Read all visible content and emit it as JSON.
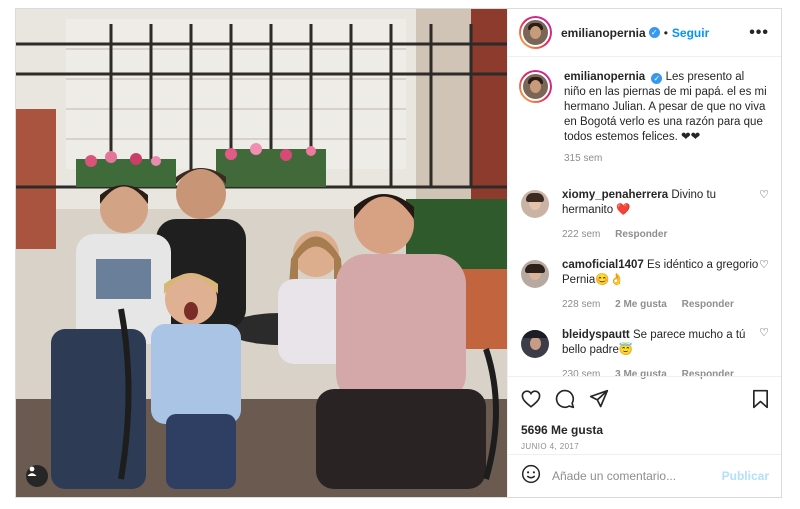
{
  "post": {
    "username": "emilianopernia",
    "follow_label": "Seguir",
    "more_label": "•••"
  },
  "caption": {
    "username": "emilianopernia",
    "text": "Les presento al niño en las piernas de mi papá. el es mi hermano Julian. A pesar de que no viva en Bogotá verlo es una razón para que todos estemos felices. ❤❤",
    "time": "315 sem"
  },
  "comments": [
    {
      "username": "xiomy_penaherrera",
      "text": "Divino tu hermanito ❤️",
      "time": "222 sem",
      "likes": "",
      "reply": "Responder"
    },
    {
      "username": "camoficial1407",
      "text": "Es idéntico a gregorio Pernia😊👌",
      "time": "228 sem",
      "likes": "2 Me gusta",
      "reply": "Responder"
    },
    {
      "username": "bleidyspautt",
      "text": "Se parece mucho a tú bello padre😇",
      "time": "230 sem",
      "likes": "3 Me gusta",
      "reply": "Responder"
    }
  ],
  "actions": {
    "likes": "5696 Me gusta",
    "date": "JUNIO 4, 2017"
  },
  "add_comment": {
    "placeholder": "Añade un comentario...",
    "publish": "Publicar"
  },
  "icons": {
    "verified": "verified-badge-icon",
    "tag": "user-tag-icon",
    "heart": "heart-icon",
    "comment": "comment-icon",
    "share": "share-icon",
    "save": "bookmark-icon",
    "emoji": "emoji-icon"
  },
  "colors": {
    "link": "#0095f6",
    "verified": "#3897f0",
    "muted": "#8e8e8e",
    "publish_disabled": "#b2dffc"
  }
}
